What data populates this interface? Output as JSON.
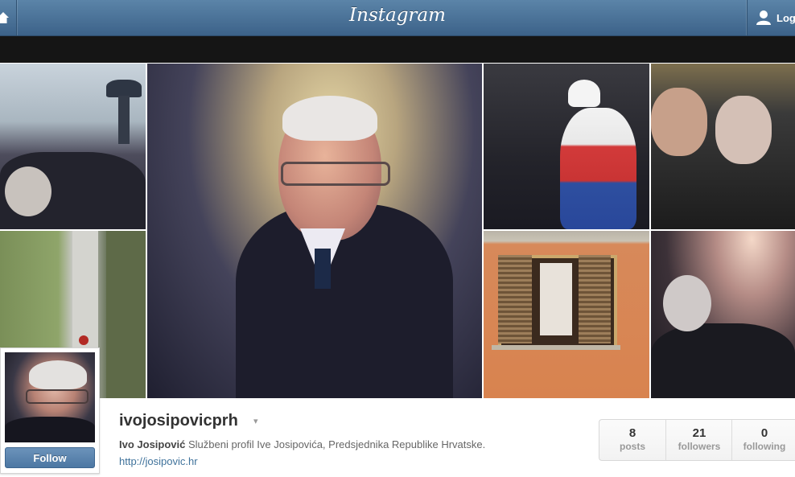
{
  "header": {
    "brand": "Instagram",
    "login_label": "Log",
    "icons": [
      "home-icon",
      "user-icon"
    ]
  },
  "photos": [
    {
      "subject": "water-tower-crowd"
    },
    {
      "subject": "rose-road-soldier"
    },
    {
      "subject": "portrait-main"
    },
    {
      "subject": "crowd-flag"
    },
    {
      "subject": "crowd-men"
    },
    {
      "subject": "brick-window"
    },
    {
      "subject": "sunlit-crowd"
    }
  ],
  "profile": {
    "username": "ivojosipovicprh",
    "caret": "▾",
    "full_name": "Ivo Josipović",
    "bio": "Službeni profil Ive Josipovića, Predsjednika Republike Hrvatske.",
    "website": "http://josipovic.hr",
    "follow_label": "Follow"
  },
  "stats": [
    {
      "value": "8",
      "label": "posts"
    },
    {
      "value": "21",
      "label": "followers"
    },
    {
      "value": "0",
      "label": "following"
    }
  ],
  "colors": {
    "header_bg": "#4a7198",
    "link": "#3f729b",
    "follow_bg": "#5a84b0"
  }
}
